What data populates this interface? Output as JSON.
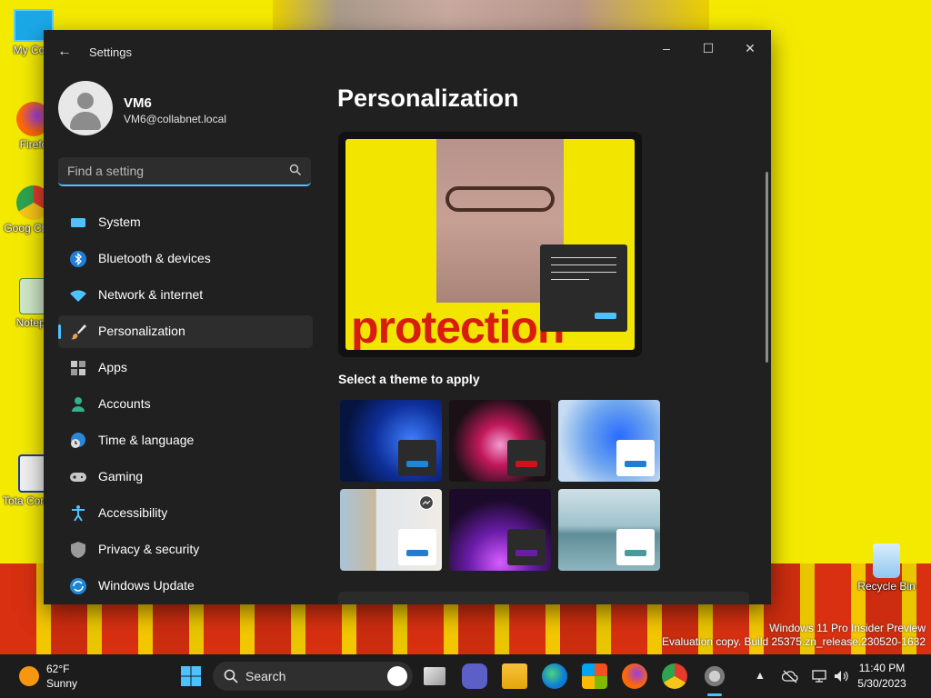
{
  "desktop": {
    "icons": [
      {
        "label": "My Com"
      },
      {
        "label": "Firefo"
      },
      {
        "label": "Goog Chron"
      },
      {
        "label": "Notepa"
      },
      {
        "label": "Tota Comma"
      },
      {
        "label": "Recycle Bin"
      }
    ],
    "watermark": {
      "line1": "Windows 11 Pro Insider Preview",
      "line2": "Evaluation copy. Build 25375.zn_release.230520-1632"
    }
  },
  "window": {
    "title": "Settings",
    "controls": {
      "minimize": "–",
      "maximize": "☐",
      "close": "✕"
    },
    "user": {
      "name": "VM6",
      "email": "VM6@collabnet.local"
    },
    "search": {
      "placeholder": "Find a setting"
    },
    "nav": [
      {
        "label": "System",
        "icon": "system-icon",
        "active": false
      },
      {
        "label": "Bluetooth & devices",
        "icon": "bluetooth-icon",
        "active": false
      },
      {
        "label": "Network & internet",
        "icon": "wifi-icon",
        "active": false
      },
      {
        "label": "Personalization",
        "icon": "brush-icon",
        "active": true
      },
      {
        "label": "Apps",
        "icon": "apps-icon",
        "active": false
      },
      {
        "label": "Accounts",
        "icon": "person-icon",
        "active": false
      },
      {
        "label": "Time & language",
        "icon": "globe-clock-icon",
        "active": false
      },
      {
        "label": "Gaming",
        "icon": "gamepad-icon",
        "active": false
      },
      {
        "label": "Accessibility",
        "icon": "accessibility-icon",
        "active": false
      },
      {
        "label": "Privacy & security",
        "icon": "shield-icon",
        "active": false
      },
      {
        "label": "Windows Update",
        "icon": "update-icon",
        "active": false
      }
    ],
    "main": {
      "title": "Personalization",
      "preview_text": "protection",
      "themes_label": "Select a theme to apply",
      "themes": [
        {
          "name": "windows-light-blue",
          "bg": "#1d4fd8",
          "mini": "#2b2b2b",
          "bar": "#1f86d6"
        },
        {
          "name": "glow",
          "bg": "#1a1015",
          "mini": "#2b2b2b",
          "bar": "#d0101a"
        },
        {
          "name": "windows-light",
          "bg": "#9ec4ea",
          "mini": "#ffffff",
          "bar": "#1f7dd6"
        },
        {
          "name": "captured-motion",
          "bg": "#b2a592",
          "mini": "#ffffff",
          "bar": "#1f7dd6"
        },
        {
          "name": "windows-dark",
          "bg": "#2a0d3d",
          "mini": "#2b2b2b",
          "bar": "#6a1ca8"
        },
        {
          "name": "flow",
          "bg": "#8fb5bf",
          "mini": "#ffffff",
          "bar": "#4a9a9c"
        }
      ]
    }
  },
  "taskbar": {
    "weather": {
      "temp": "62°F",
      "condition": "Sunny"
    },
    "search_label": "Search",
    "time": "11:40 PM",
    "date": "5/30/2023"
  }
}
